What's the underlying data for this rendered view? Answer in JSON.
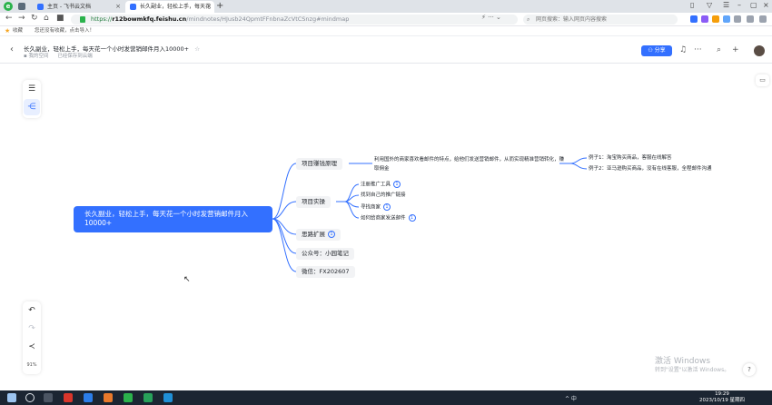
{
  "browser": {
    "tabs": [
      {
        "label": "主页 - 飞书云文档",
        "fav_color": "#3370ff"
      },
      {
        "label": "长久副业，轻松上手，每天花",
        "fav_color": "#3370ff"
      }
    ],
    "new_tab": "+",
    "url_host": "r12bowmkfq.feishu.cn",
    "url_prefix": "https://",
    "url_path": "/mindnotes/HJusb24QpmtFFnbnaZcVtCSnzg#mindmap",
    "search_placeholder": "网页搜索：输入网页内容搜索",
    "bookmarks_label": "收藏",
    "bookmarks_hint": "您还没有收藏，点击导入！"
  },
  "doc": {
    "title": "长久副业，轻松上手，每天花一个小时发营销邮件月入10000+",
    "location": "我的空间",
    "save_status": "已经保存到云端",
    "share_label": "分享"
  },
  "toolbar": {
    "zoom": "91%"
  },
  "mindmap": {
    "root": "长久副业，轻松上手，每天花一个小时发营销邮件月入10000+",
    "branches": {
      "b1": "项目赚钱原理",
      "b1_detail": "利用国外的商家喜欢看邮件的特点，给他们发送营销邮件，从而实现精准营销转化，赚取佣金",
      "b1_ex1": "例子1：淘宝购买商品，客服在线解答",
      "b1_ex2": "例子2：亚马逊购买商品，没有在线客服，全程邮件沟通",
      "b2": "项目实操",
      "b2_c1": "注册推广工具",
      "b2_c2": "找到自己的推广链接",
      "b2_c3": "寻找商家",
      "b2_c4": "如何给商家发送邮件",
      "b3": "思路扩展",
      "b4": "公众号：小园笔记",
      "b5": "微信：FX202607",
      "badge": "1"
    }
  },
  "watermark": {
    "line1": "激活 Windows",
    "line2": "转到\"设置\"以激活 Windows。"
  },
  "taskbar": {
    "tray_text": "^ 中",
    "time": "19:29",
    "date": "2023/10/19 星期四"
  }
}
